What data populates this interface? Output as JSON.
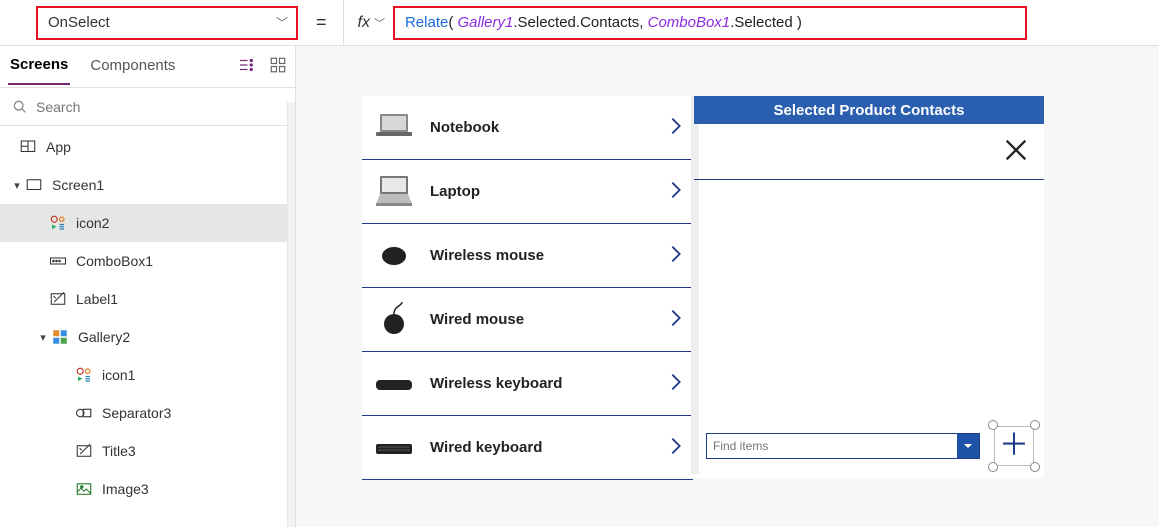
{
  "formula": {
    "property": "OnSelect",
    "equals": "=",
    "fx_label": "fx",
    "tokens": {
      "func": "Relate",
      "open": "( ",
      "obj1": "Gallery1",
      "mid1": ".Selected.Contacts, ",
      "obj2": "ComboBox1",
      "mid2": ".Selected )"
    }
  },
  "tree_panel": {
    "tabs": {
      "screens": "Screens",
      "components": "Components"
    },
    "search_placeholder": "Search",
    "items": {
      "app": "App",
      "screen1": "Screen1",
      "icon2": "icon2",
      "combobox1": "ComboBox1",
      "label1": "Label1",
      "gallery2": "Gallery2",
      "icon1": "icon1",
      "separator3": "Separator3",
      "title3": "Title3",
      "image3": "Image3"
    }
  },
  "gallery": [
    {
      "label": "Notebook"
    },
    {
      "label": "Laptop"
    },
    {
      "label": "Wireless mouse"
    },
    {
      "label": "Wired mouse"
    },
    {
      "label": "Wireless keyboard"
    },
    {
      "label": "Wired keyboard"
    }
  ],
  "right_pane": {
    "header": "Selected Product Contacts",
    "combo_placeholder": "Find items"
  }
}
